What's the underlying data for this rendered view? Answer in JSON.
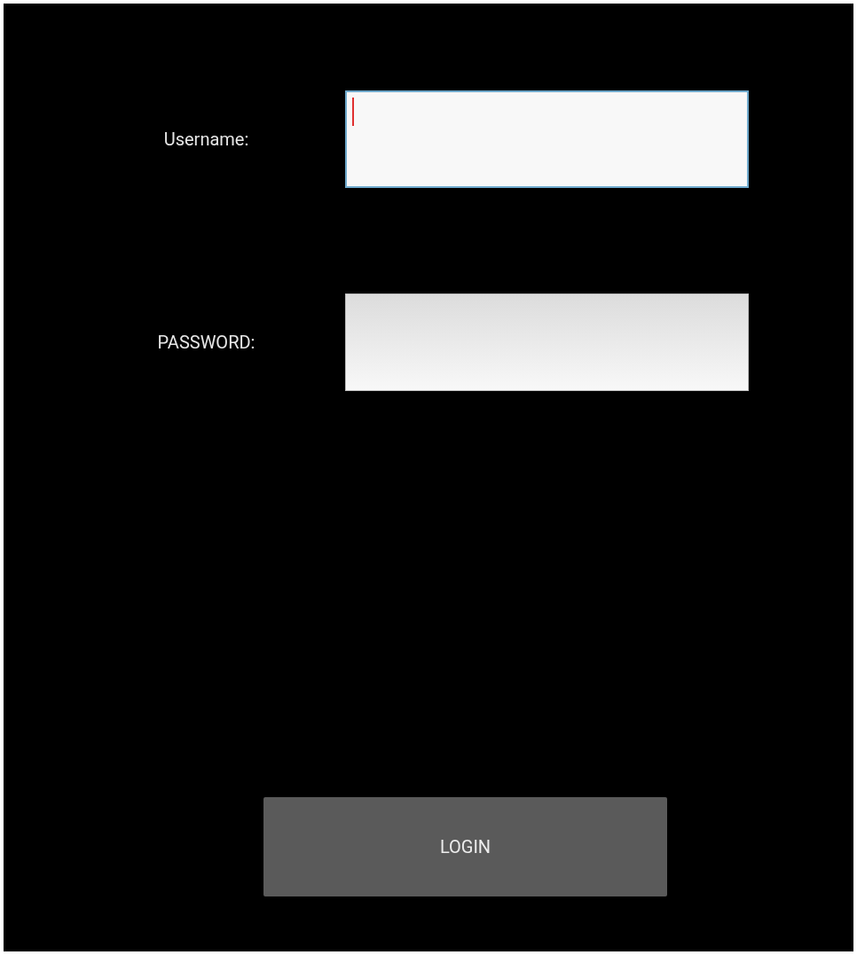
{
  "fields": [
    {
      "label": "Username:",
      "focused": true
    },
    {
      "label": "PASSWORD:",
      "focused": false
    }
  ],
  "button": "LOGIN"
}
